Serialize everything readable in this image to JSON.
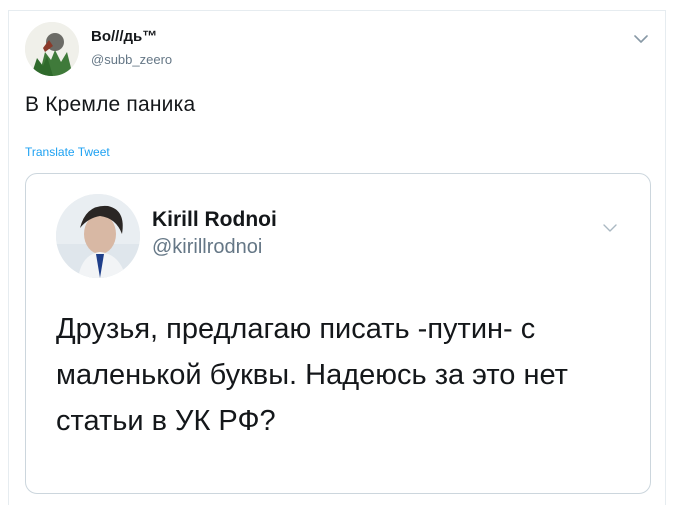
{
  "tweet": {
    "author": {
      "name": "Во///дь™",
      "handle": "@subb_zeero"
    },
    "text": "В Кремле паника",
    "translate_label": "Translate Tweet"
  },
  "quoted_tweet": {
    "author": {
      "name": "Kirill Rodnoi",
      "handle": "@kirillrodnoi"
    },
    "text": "Друзья, предлагаю писать -путин- с маленькой буквы. Надеюсь за это нет статьи в УК РФ?"
  },
  "icons": [
    "avatar-image",
    "chevron-down-icon"
  ],
  "colors": {
    "link": "#1da1f2",
    "secondary_text": "#657786",
    "primary_text": "#14171a",
    "border": "#ccd6dd"
  }
}
